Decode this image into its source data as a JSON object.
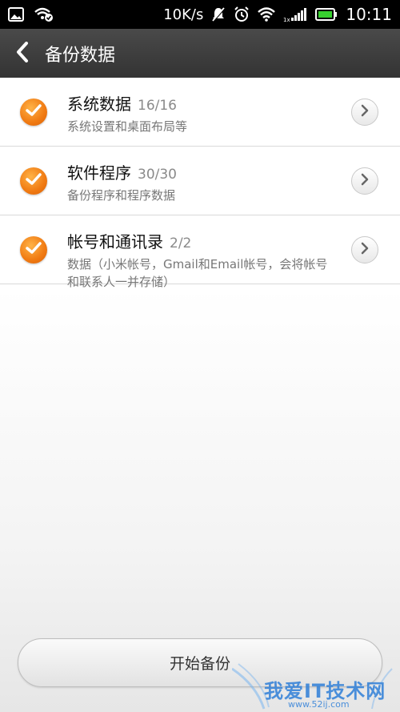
{
  "status_bar": {
    "speed": "10K/s",
    "time": "10:11",
    "icons": [
      "image-icon",
      "wifi-sync-icon",
      "mute-icon",
      "alarm-icon",
      "wifi-icon",
      "signal-icon",
      "battery-icon"
    ],
    "battery_color": "#37d12f"
  },
  "header": {
    "title": "备份数据"
  },
  "items": [
    {
      "title": "系统数据",
      "count": "16/16",
      "desc": "系统设置和桌面布局等",
      "checked": true
    },
    {
      "title": "软件程序",
      "count": "30/30",
      "desc": "备份程序和程序数据",
      "checked": true
    },
    {
      "title": "帐号和通讯录",
      "count": "2/2",
      "desc": "数据（小米帐号，Gmail和Email帐号，会将帐号和联系人一并存储）",
      "checked": true
    }
  ],
  "footer": {
    "start_label": "开始备份"
  },
  "watermark": {
    "text": "我爱IT技术网",
    "url": "www.52ij.com"
  },
  "colors": {
    "accent": "#f07a12",
    "title_bar": "#3d3d3d"
  }
}
